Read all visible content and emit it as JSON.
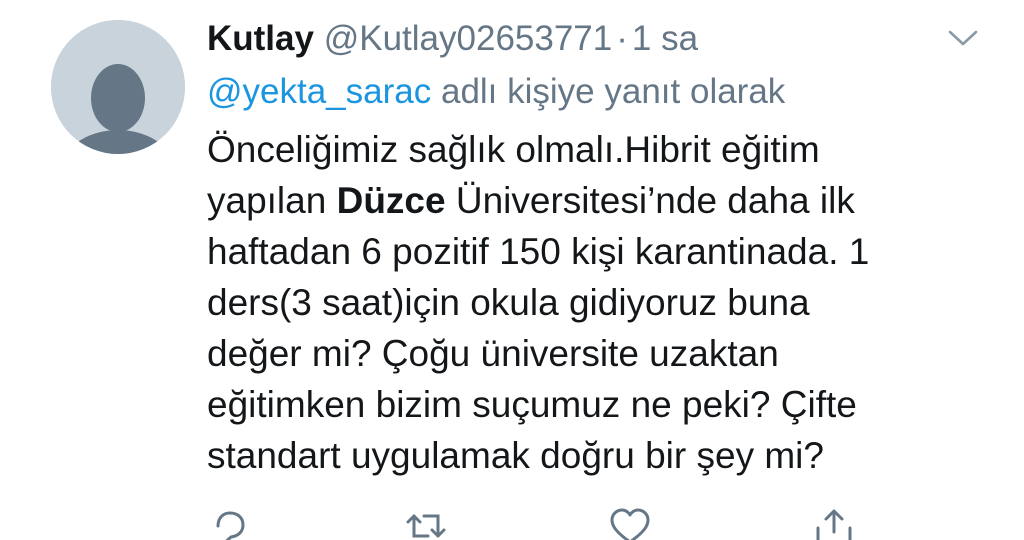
{
  "tweet": {
    "display_name": "Kutlay",
    "handle": "@Kutlay02653771",
    "separator": "·",
    "time": "1 sa",
    "reply_mention": "@yekta_sarac",
    "reply_suffix": " adlı kişiye yanıt olarak",
    "body": {
      "line1": "Önceliğimiz sağlık olmalı.Hibrit eğitim",
      "line2_pre": "yapılan ",
      "line2_bold": "Düzce",
      "line2_post": " Üniversitesi’nde daha ilk",
      "line3": "haftadan 6 pozitif 150 kişi karantinada. 1",
      "line4": "ders(3 saat)için okula gidiyoruz buna",
      "line5": "değer mi? Çoğu üniversite uzaktan",
      "line6": "eğitimken bizim suçumuz ne peki? Çifte",
      "line7": "standart uygulamak doğru bir şey mi?"
    }
  },
  "icons": {
    "avatar": "default-profile-avatar",
    "menu": "chevron-down-icon",
    "reply": "reply-icon",
    "retweet": "retweet-icon",
    "like": "heart-icon",
    "share": "share-icon"
  },
  "colors": {
    "text": "#14171a",
    "secondary": "#657786",
    "link": "#1b95e0",
    "avatar_bg": "#c8d3db",
    "avatar_fg": "#657786"
  }
}
